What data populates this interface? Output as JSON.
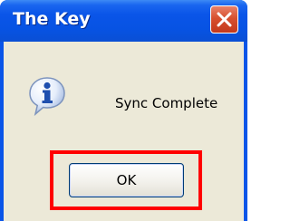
{
  "window": {
    "title": "The Key"
  },
  "dialog": {
    "message": "Sync Complete",
    "icon": "information-icon",
    "ok_label": "OK"
  },
  "colors": {
    "titlebar": "#0A55E8",
    "close_button": "#D7502F",
    "dialog_background": "#ECE9D8",
    "highlight": "#FF0000"
  }
}
